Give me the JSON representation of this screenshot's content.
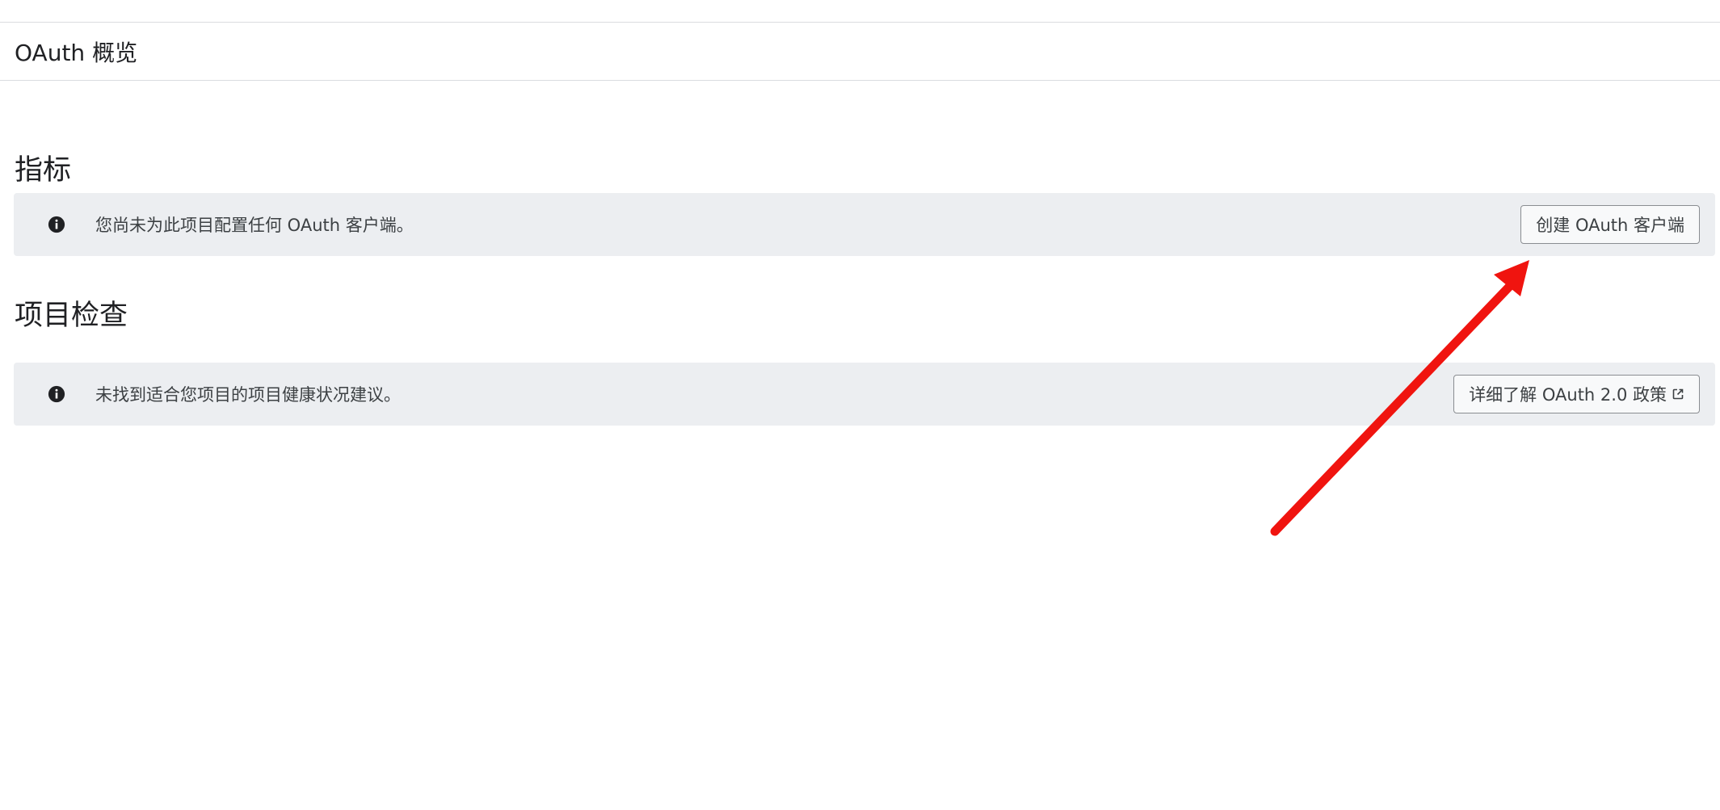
{
  "header": {
    "title": "OAuth 概览"
  },
  "metrics": {
    "heading": "指标",
    "banner_text": "您尚未为此项目配置任何 OAuth 客户端。",
    "button_label": "创建 OAuth 客户端"
  },
  "project_checks": {
    "heading": "项目检查",
    "banner_text": "未找到适合您项目的项目健康状况建议。",
    "button_label": "详细了解 OAuth 2.0 政策"
  },
  "colors": {
    "banner_background": "#eceef1",
    "annotation_arrow": "#f0140f",
    "text_primary": "#202124"
  },
  "icons": {
    "info": "info-icon",
    "external_link": "external-link-icon",
    "annotation": "red-arrow"
  }
}
